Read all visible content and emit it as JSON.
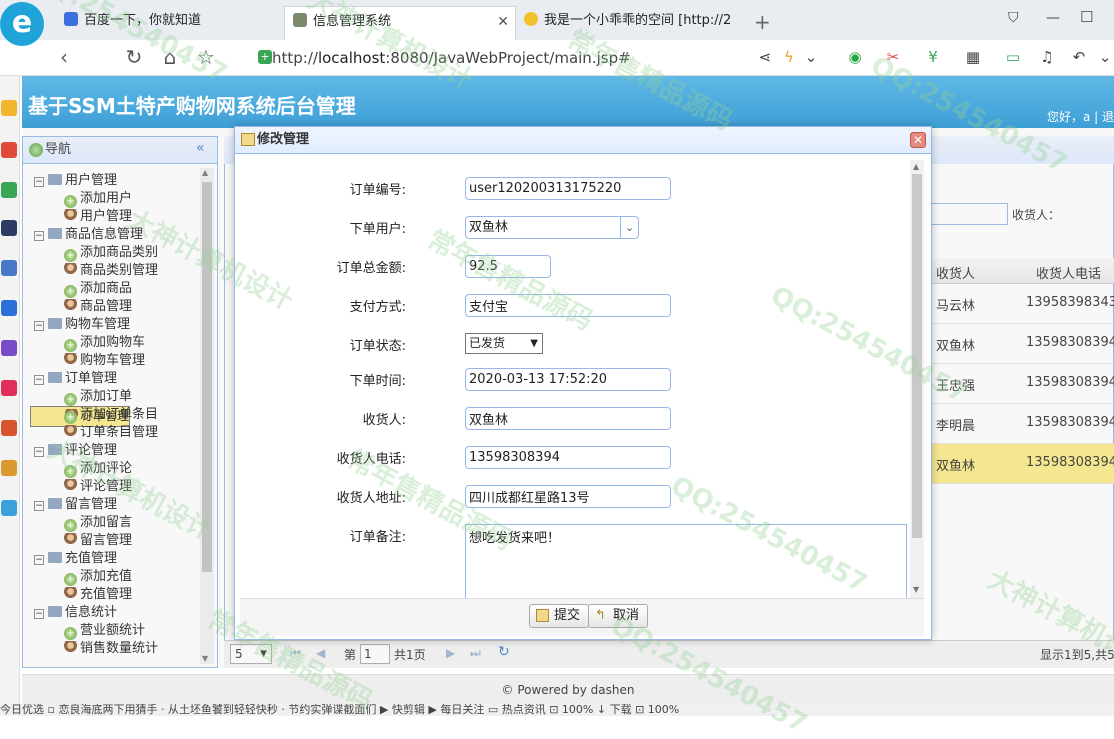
{
  "browser": {
    "tabs": [
      {
        "title": "百度一下，你就知道",
        "active": false
      },
      {
        "title": "信息管理系统",
        "active": true
      },
      {
        "title": "我是一个小乖乖的空间 [http://2",
        "active": false
      }
    ],
    "new_tab": "+",
    "url_prefix": "http://",
    "url_host": "localhost",
    "url_path": ":8080/JavaWebProject/main.jsp#"
  },
  "app": {
    "title": "基于SSM土特产购物网系统后台管理",
    "greeting": "您好，a | 退"
  },
  "nav": {
    "header": "导航",
    "groups": [
      {
        "label": "用户管理",
        "items": [
          {
            "label": "添加用户",
            "type": "add"
          },
          {
            "label": "用户管理",
            "type": "user"
          }
        ]
      },
      {
        "label": "商品信息管理",
        "items": [
          {
            "label": "添加商品类别",
            "type": "add"
          },
          {
            "label": "商品类别管理",
            "type": "user"
          },
          {
            "label": "添加商品",
            "type": "add"
          },
          {
            "label": "商品管理",
            "type": "user"
          }
        ]
      },
      {
        "label": "购物车管理",
        "items": [
          {
            "label": "添加购物车",
            "type": "add"
          },
          {
            "label": "购物车管理",
            "type": "user"
          }
        ]
      },
      {
        "label": "订单管理",
        "items": [
          {
            "label": "添加订单",
            "type": "add"
          },
          {
            "label": "订单管理",
            "type": "user",
            "selected": true
          },
          {
            "label": "添加订单条目",
            "type": "add"
          },
          {
            "label": "订单条目管理",
            "type": "user"
          }
        ]
      },
      {
        "label": "评论管理",
        "items": [
          {
            "label": "添加评论",
            "type": "add"
          },
          {
            "label": "评论管理",
            "type": "user"
          }
        ]
      },
      {
        "label": "留言管理",
        "items": [
          {
            "label": "添加留言",
            "type": "add"
          },
          {
            "label": "留言管理",
            "type": "user"
          }
        ]
      },
      {
        "label": "充值管理",
        "items": [
          {
            "label": "添加充值",
            "type": "add"
          },
          {
            "label": "充值管理",
            "type": "user"
          }
        ]
      },
      {
        "label": "信息统计",
        "items": [
          {
            "label": "营业额统计",
            "type": "add"
          },
          {
            "label": "销售数量统计",
            "type": "user"
          }
        ]
      }
    ]
  },
  "grid": {
    "search_label": "收货人：",
    "headers": [
      "收货人",
      "收货人电话"
    ],
    "rows": [
      {
        "name": "马云林",
        "phone": "13958398343"
      },
      {
        "name": "双鱼林",
        "phone": "13598308394"
      },
      {
        "name": "王忠强",
        "phone": "13598308394"
      },
      {
        "name": "李明晨",
        "phone": "13598308394"
      },
      {
        "name": "双鱼林",
        "phone": "13598308394",
        "selected": true
      }
    ],
    "page_size": "5",
    "page_label_pre": "第",
    "page_no": "1",
    "page_label_post": "共1页",
    "summary": "显示1到5,共5"
  },
  "footer": "© Powered by dashen",
  "dialog": {
    "title": "修改管理",
    "fields": {
      "order_no": {
        "label": "订单编号:",
        "value": "user120200313175220"
      },
      "user": {
        "label": "下单用户:",
        "value": "双鱼林"
      },
      "amount": {
        "label": "订单总金额:",
        "value": "92.5"
      },
      "pay": {
        "label": "支付方式:",
        "value": "支付宝"
      },
      "status": {
        "label": "订单状态:",
        "value": "已发货"
      },
      "time": {
        "label": "下单时间:",
        "value": "2020-03-13 17:52:20"
      },
      "receiver": {
        "label": "收货人:",
        "value": "双鱼林"
      },
      "phone": {
        "label": "收货人电话:",
        "value": "13598308394"
      },
      "address": {
        "label": "收货人地址:",
        "value": "四川成都红星路13号"
      },
      "remark": {
        "label": "订单备注:",
        "value": "想吃发货来吧！"
      }
    },
    "submit": "提交",
    "cancel": "取消"
  },
  "statusbar": "今日优选   ▫ 恋良海底两下用猜手 · 从土坯鱼饕到轻轻快秒 · 节约实弹谍截面们                    ▶ 快剪辑   ▶ 每日关注   ▭ 热点资讯   ⊡ 100%  ↓ 下载   ⊡  100%",
  "watermarks": [
    "QQ:254540457",
    "大神计算机设计",
    "常年售精品源码"
  ]
}
